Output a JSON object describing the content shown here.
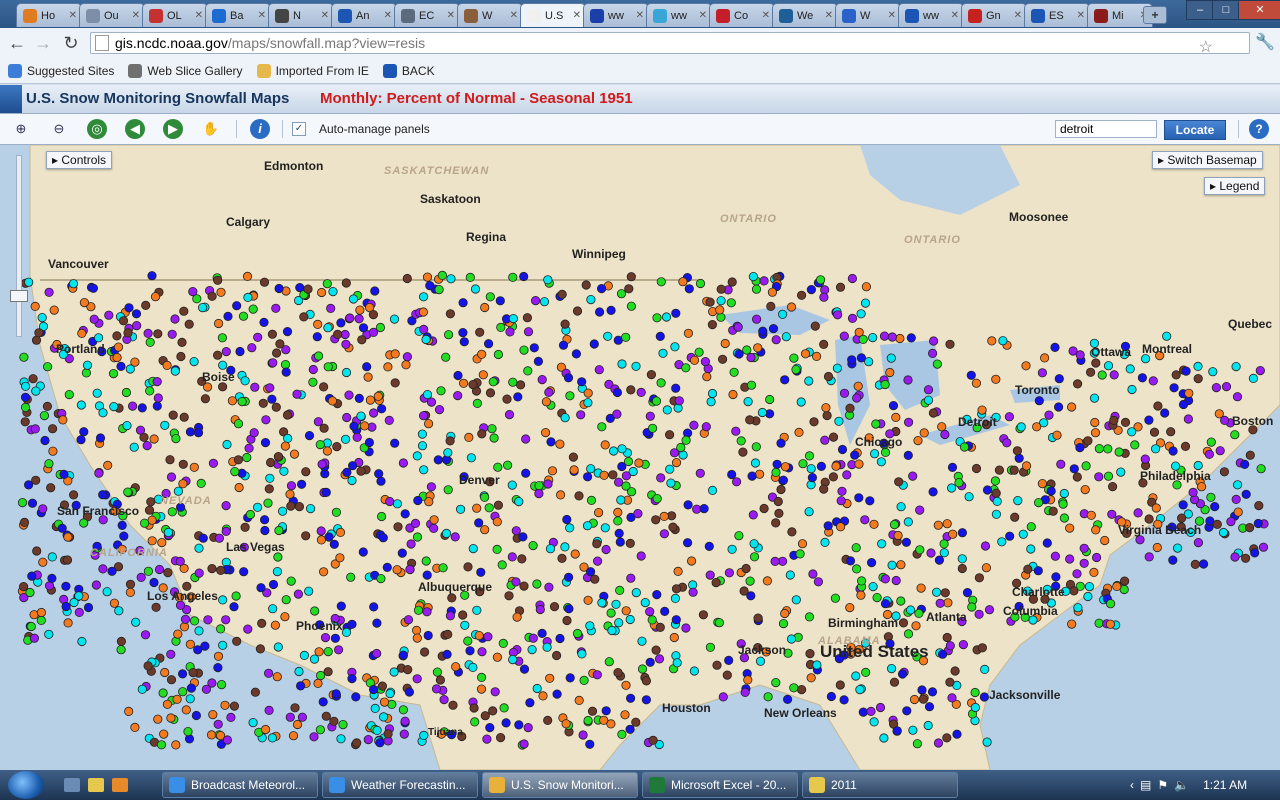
{
  "browser": {
    "tabs": [
      {
        "label": "Ho",
        "color": "#e07b1f"
      },
      {
        "label": "Ou",
        "color": "#7d8fa8"
      },
      {
        "label": "OL",
        "color": "#c53030"
      },
      {
        "label": "Ba",
        "color": "#1b6bd1"
      },
      {
        "label": "N",
        "color": "#444444"
      },
      {
        "label": "An",
        "color": "#1b56b5"
      },
      {
        "label": "EC",
        "color": "#5b6b7d"
      },
      {
        "label": "W",
        "color": "#8a5d3b"
      },
      {
        "label": "U.S",
        "color": "#f0f0f0",
        "active": true
      },
      {
        "label": "ww",
        "color": "#1a3fa8"
      },
      {
        "label": "ww",
        "color": "#3aa6d8"
      },
      {
        "label": "Co",
        "color": "#c41e2a"
      },
      {
        "label": "We",
        "color": "#1f5f99"
      },
      {
        "label": "W",
        "color": "#2a62c9"
      },
      {
        "label": "ww",
        "color": "#1b56b5"
      },
      {
        "label": "Gn",
        "color": "#c5221f"
      },
      {
        "label": "ES",
        "color": "#1b56b5"
      },
      {
        "label": "Mi",
        "color": "#8b1a1a"
      }
    ],
    "new_tab_glyph": "+",
    "url_host": "gis.ncdc.noaa.gov",
    "url_path": "/maps/snowfall.map?view=resis",
    "bookmarks": [
      {
        "label": "Suggested Sites",
        "color": "#3b7dd8"
      },
      {
        "label": "Web Slice Gallery",
        "color": "#707070"
      },
      {
        "label": "Imported From IE",
        "color": "#e6b84c"
      },
      {
        "label": "BACK",
        "color": "#1b56b5"
      }
    ]
  },
  "app": {
    "title": "U.S. Snow Monitoring Snowfall Maps",
    "subtitle": "Monthly: Percent of Normal - Seasonal 1951",
    "auto_manage_label": "Auto-manage panels",
    "search_value": "detroit",
    "locate_label": "Locate",
    "help_glyph": "?",
    "controls_label": "Controls",
    "switch_basemap_label": "Switch Basemap",
    "legend_label": "Legend",
    "station_colors": [
      "#f47a20",
      "#6b3a2a",
      "#22dd22",
      "#00e5ee",
      "#9a1bf2",
      "#1414e8"
    ]
  },
  "map_labels": {
    "provinces": [
      "SASKATCHEWAN",
      "ONTARIO",
      "ONTARIO",
      "NEVADA",
      "CALIFORNIA",
      "ALABAMA"
    ],
    "cities": [
      "Edmonton",
      "Saskatoon",
      "Calgary",
      "Regina",
      "Winnipeg",
      "Moosonee",
      "Vancouver",
      "Portland",
      "Boise",
      "Denver",
      "Chicago",
      "Detroit",
      "Toronto",
      "Ottawa",
      "Montreal",
      "Quebec",
      "Boston",
      "Philadelphia",
      "Charlotte",
      "Columbia",
      "Atlanta",
      "Birmingham",
      "Jackson",
      "Houston",
      "New Orleans",
      "Jacksonville",
      "San Francisco",
      "Las Vegas",
      "Los Angeles",
      "Phoenix",
      "Albuquerque",
      "Virginia Beach",
      "Tijuana"
    ],
    "country": "United States"
  },
  "taskbar": {
    "items": [
      {
        "label": "Broadcast Meteorol...",
        "color": "#3a8ee6"
      },
      {
        "label": "Weather Forecastin...",
        "color": "#3a8ee6"
      },
      {
        "label": "U.S. Snow Monitori...",
        "color": "#e8b23a",
        "active": true
      },
      {
        "label": "Microsoft Excel - 20...",
        "color": "#1f7a3a"
      },
      {
        "label": "2011",
        "color": "#e6c84c"
      }
    ],
    "clock": "1:21 AM"
  }
}
